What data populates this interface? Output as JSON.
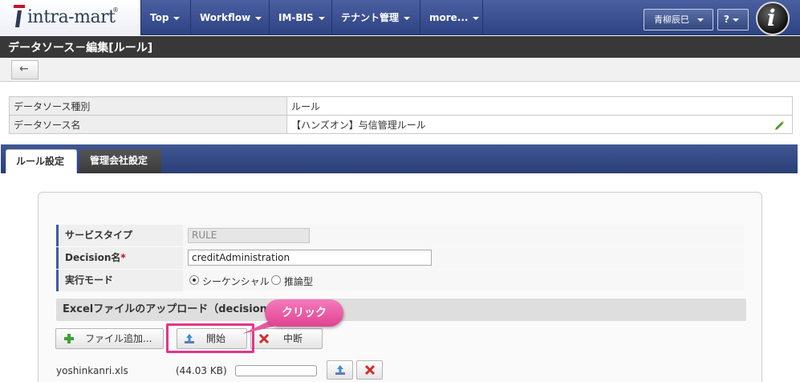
{
  "header": {
    "logo_text": "intra-mart",
    "logo_reg": "®",
    "nav": [
      {
        "label": "Top"
      },
      {
        "label": "Workflow"
      },
      {
        "label": "IM-BIS"
      },
      {
        "label": "テナント管理"
      },
      {
        "label": "more..."
      }
    ],
    "user_label": "青柳辰巳",
    "help_label": "?",
    "brand_icon_letter": "i"
  },
  "page": {
    "title": "データソース－編集[ルール]",
    "back_icon": "←"
  },
  "info": {
    "rows": [
      {
        "label": "データソース種別",
        "value": "ルール"
      },
      {
        "label": "データソース名",
        "value": "【ハンズオン】与信管理ルール"
      }
    ]
  },
  "tabs": [
    {
      "label": "ルール設定"
    },
    {
      "label": "管理会社設定"
    }
  ],
  "form": {
    "service_type_label": "サービスタイプ",
    "service_type_value": "RULE",
    "decision_label": "Decision名",
    "required_mark": "*",
    "decision_value": "creditAdministration",
    "mode_label": "実行モード",
    "mode_options": [
      {
        "label": "シーケンシャル",
        "selected": true
      },
      {
        "label": "推論型",
        "selected": false
      }
    ]
  },
  "upload": {
    "section_title": "Excelファイルのアップロード（decisionファ",
    "add_button": "ファイル追加...",
    "start_button": "開始",
    "cancel_button": "中断",
    "callout": "クリック",
    "file_name": "yoshinkanri.xls",
    "file_size": "(44.03 KB)"
  },
  "colors": {
    "nav_bg": "#2e4383",
    "highlight": "#e0368c",
    "accent_bar": "#3d5aa8"
  }
}
